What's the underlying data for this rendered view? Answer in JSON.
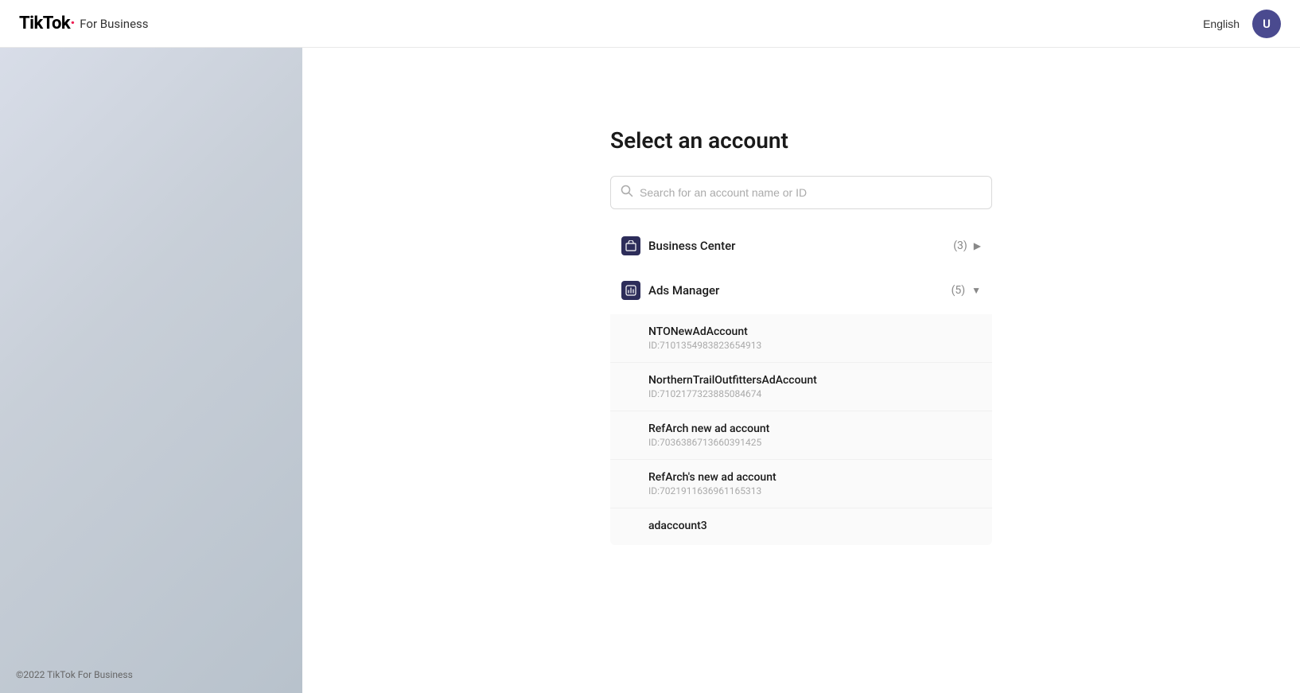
{
  "header": {
    "logo": {
      "brand": "TikTok",
      "separator": "·",
      "subtitle": "For Business"
    },
    "language": "English",
    "user_avatar_initial": "U"
  },
  "footer": {
    "copyright": "©2022 TikTok For Business"
  },
  "main": {
    "title": "Select an account",
    "search": {
      "placeholder": "Search for an account name or ID"
    },
    "categories": [
      {
        "id": "business-center",
        "label": "Business Center",
        "count": "(3)",
        "expanded": false,
        "chevron": "▶"
      },
      {
        "id": "ads-manager",
        "label": "Ads Manager",
        "count": "(5)",
        "expanded": true,
        "chevron": "▼"
      }
    ],
    "accounts": [
      {
        "name": "NTONewAdAccount",
        "id": "ID:71013549838236 54913"
      },
      {
        "name": "NorthernTrailOutfittersAdAccount",
        "id": "ID:7102177323885084674"
      },
      {
        "name": "RefArch new ad account",
        "id": "ID:7036386713660391425"
      },
      {
        "name": "RefArch's new ad account",
        "id": "ID:7021911636961165313"
      },
      {
        "name": "adaccount3",
        "id": ""
      }
    ]
  }
}
